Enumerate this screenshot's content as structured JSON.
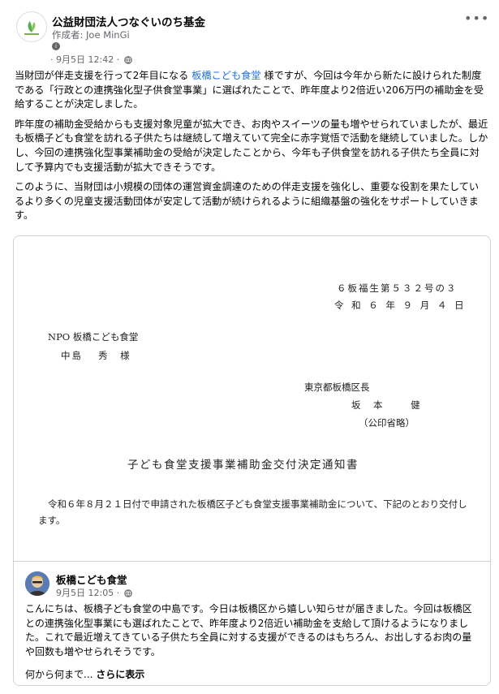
{
  "header": {
    "org_name": "公益財団法人つなぐいのち基金",
    "author_label": "作成者: ",
    "author_name": "Joe MinGi",
    "date_time": "9月5日 12:42",
    "more_icon": "more-horizontal-icon"
  },
  "post": {
    "p1_before_link": "当財団が伴走支援を行って2年目になる ",
    "p1_link": "板橋こども食堂",
    "p1_after_link": " 様ですが、今回は今年から新たに設けられた制度である「行政との連携強化型子供食堂事業」に選ばれたことで、昨年度より2倍近い206万円の補助金を受給することが決定しました。",
    "p2": "昨年度の補助金受給からも支援対象児童が拡大でき、お肉やスイーツの量も増やせられていましたが、最近も板橋子ども食堂を訪れる子供たちは継続して増えていて完全に赤字覚悟で活動を継続していました。しかし、今回の連携強化型事業補助金の受給が決定したことから、今年も子供食堂を訪れる子供たち全員に対して予算内でも支援活動が拡大できそうです。",
    "p3": "このように、当財団は小規模の団体の運営資金調達のための伴走支援を強化し、重要な役割を果たしているより多くの児童支援活動団体が安定して活動が続けられるように組織基盤の強化をサポートしていきます。"
  },
  "document": {
    "ref_no": "６板福生第５３２号の３",
    "date": "令 和 ６ 年 ９ 月 ４ 日",
    "to_org": "NPO 板橋こども食堂",
    "to_name": "中島　 秀　様",
    "from_office": "東京都板橋区長",
    "from_name": "坂　本　　 健",
    "seal_note": "（公印省略）",
    "title": "子ども食堂支援事業補助金交付決定通知書",
    "body": "令和６年８月２１日付で申請された板橋区子ども食堂支援事業補助金について、下記のとおり交付します。"
  },
  "shared_post": {
    "name": "板橋こども食堂",
    "date_time": "9月5日 12:05",
    "text": "こんにちは、板橋子ども食堂の中島です。今日は板橋区から嬉しい知らせが届きました。今回は板橋区との連携強化型事業にも選ばれたことで、昨年度より2倍近い補助金を支給して頂けるようになりました。これで最近増えてきている子供たち全員に対する支援ができるのはもちろん、お出しするお肉の量や回数も増やせられそうです。",
    "truncated_text": "何から何まで...",
    "see_more": "さらに表示"
  },
  "colors": {
    "link": "#216fdb",
    "meta_text": "#65676b",
    "border": "#ced0d4"
  }
}
